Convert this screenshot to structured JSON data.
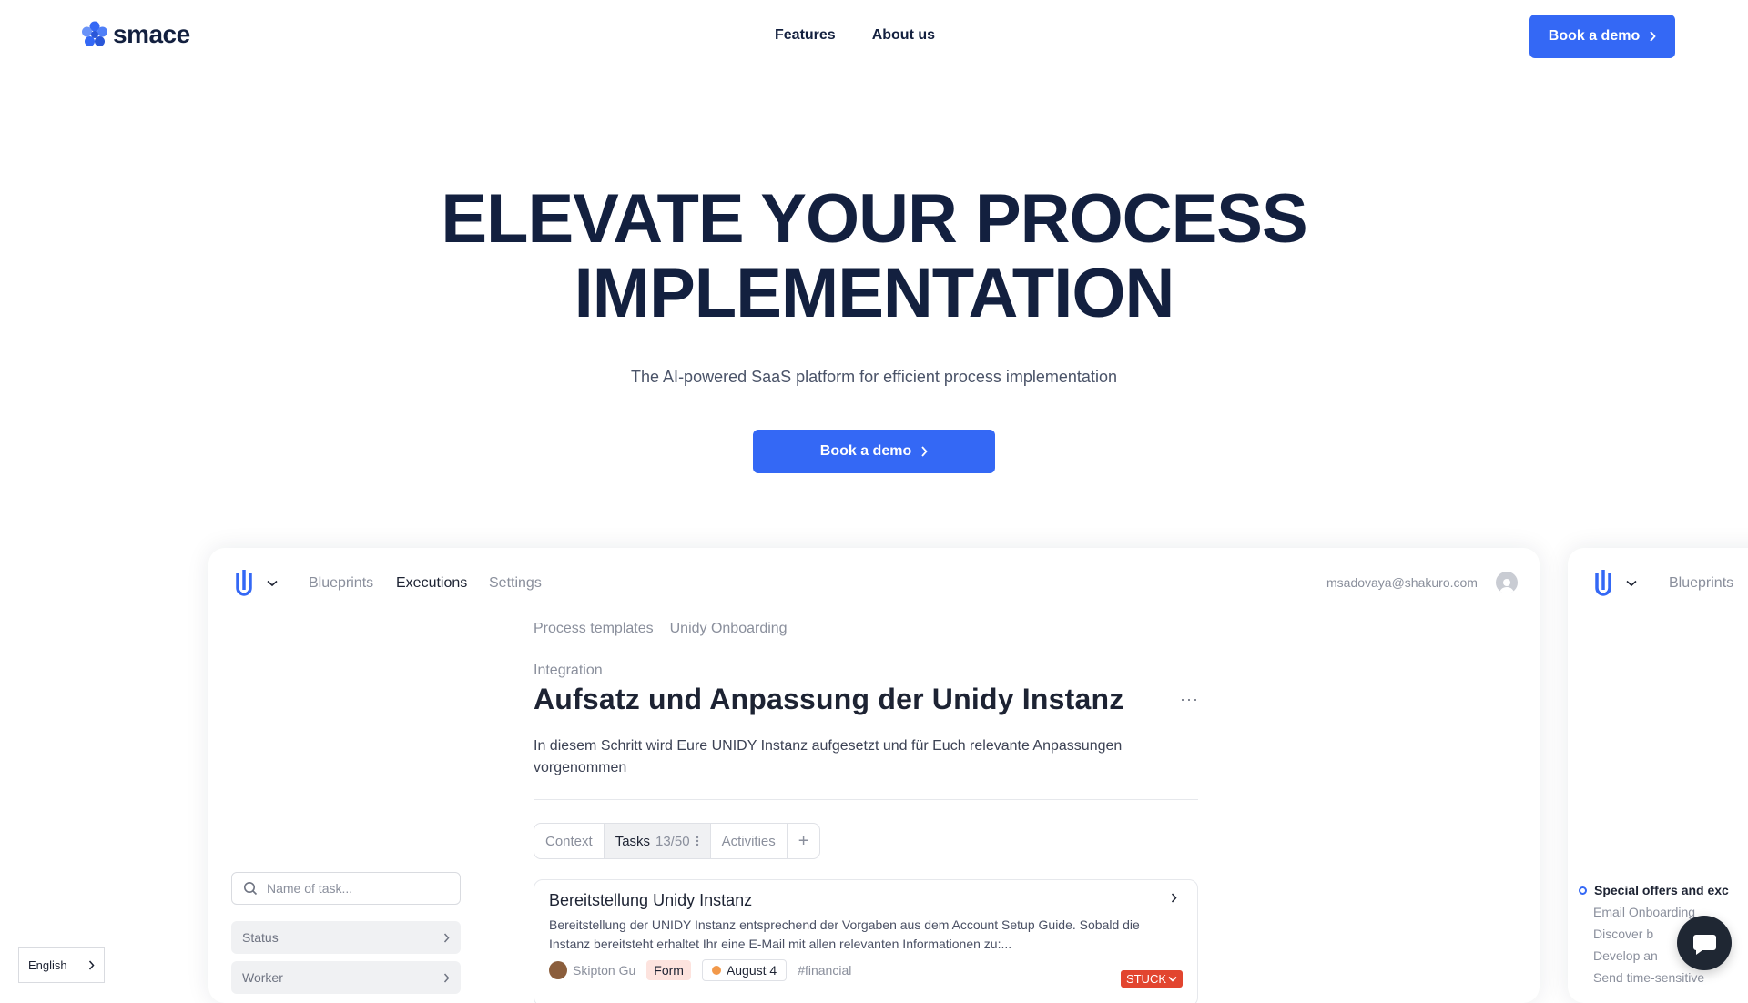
{
  "brand": {
    "name": "smace"
  },
  "nav": {
    "links": [
      "Features",
      "About us"
    ],
    "cta": "Book a demo"
  },
  "hero": {
    "title_line1": "ELEVATE YOUR PROCESS",
    "title_line2": "IMPLEMENTATION",
    "subtitle": "The AI-powered SaaS platform for efficient process implementation",
    "cta": "Book a demo"
  },
  "app": {
    "tabs": [
      "Blueprints",
      "Executions",
      "Settings"
    ],
    "active_tab": "Executions",
    "user_email": "msadovaya@shakuro.com",
    "search_placeholder": "Name of task...",
    "filters": [
      "Status",
      "Worker"
    ],
    "breadcrumb": [
      "Process templates",
      "Unidy Onboarding"
    ],
    "section": "Integration",
    "step_title": "Aufsatz und Anpassung der Unidy Instanz",
    "more": "···",
    "step_description": "In diesem Schritt wird Eure UNIDY Instanz aufgesetzt und für Euch relevante Anpassungen vorgenommen",
    "segments": {
      "context": "Context",
      "tasks": "Tasks",
      "tasks_count": "13/50",
      "activities": "Activities",
      "add": "+"
    },
    "task": {
      "title": "Bereitstellung Unidy Instanz",
      "description": "Bereitstellung der UNIDY Instanz entsprechend der Vorgaben aus dem Account Setup Guide. Sobald die Instanz bereitsteht erhaltet Ihr eine E-Mail mit allen relevanten Informationen zu:...",
      "assignee": "Skipton Gu",
      "type": "Form",
      "due": "August 4",
      "tag": "#financial",
      "status": "STUCK"
    }
  },
  "app2": {
    "tab": "Blueprints",
    "list_heading": "Special offers and exc",
    "list_items": [
      "Email Onboarding",
      "Discover b",
      "Develop an",
      "Send time-sensitive"
    ]
  },
  "language": "English",
  "colors": {
    "accent": "#3468f5",
    "text": "#13203f",
    "stuck": "#e2452f"
  }
}
